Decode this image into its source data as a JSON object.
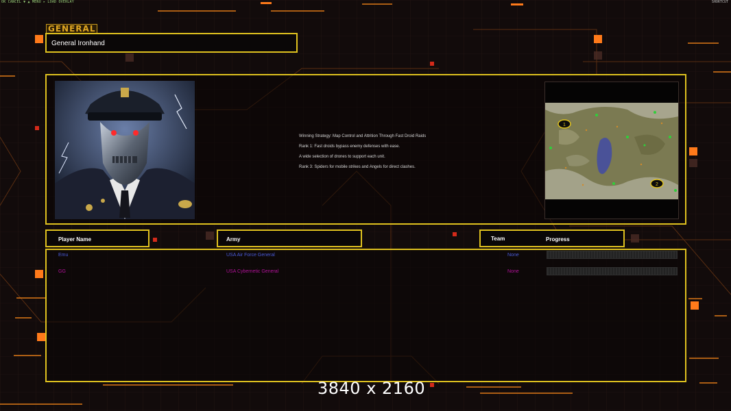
{
  "topbar": {
    "left_text": "OK CANCEL ▼ ▲ MENU ▸ LOAD OVERLAY",
    "right_text": "SHORTCUT"
  },
  "general_tag": "GENERAL",
  "general_name": "General Ironhand",
  "strategy_lines": [
    "Winning Strategy: Map Control and Attrition Through Fast Droid Raids",
    "Rank 1: Fast droids bypass enemy defenses with ease.",
    "A wide selection of drones to support each unit.",
    "Rank 3: Spiders for mobile strikes and Angels for direct clashes."
  ],
  "minimap": {
    "markers": [
      "1",
      "2"
    ]
  },
  "headers": {
    "player_name": "Player Name",
    "army": "Army",
    "team": "Team",
    "progress": "Progress"
  },
  "players": [
    {
      "name": "Emu",
      "army": "USA Air Force General",
      "team": "None",
      "color": "#4a5bd8",
      "progress": 0
    },
    {
      "name": "GG",
      "army": "USA Cybernetic General",
      "team": "None",
      "color": "#b3129a",
      "progress": 0
    }
  ],
  "resolution_label": "3840 x 2160",
  "colors": {
    "frame": "#e0c21f",
    "accent": "#ff7a1a",
    "background": "#120b0b"
  }
}
